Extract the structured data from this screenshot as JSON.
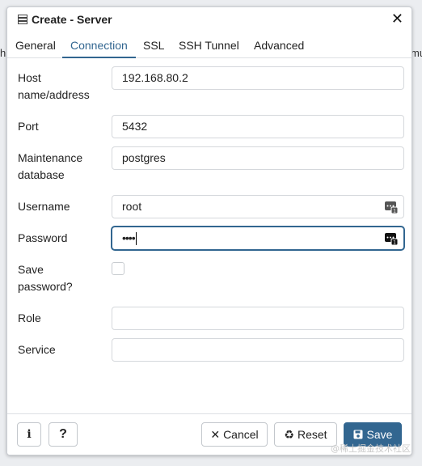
{
  "window": {
    "title": "Create - Server"
  },
  "tabs": [
    {
      "label": "General"
    },
    {
      "label": "Connection"
    },
    {
      "label": "SSL"
    },
    {
      "label": "SSH Tunnel"
    },
    {
      "label": "Advanced"
    }
  ],
  "active_tab": "Connection",
  "fields": {
    "host": {
      "label": "Host name/address",
      "value": "192.168.80.2"
    },
    "port": {
      "label": "Port",
      "value": "5432"
    },
    "maintenance_db": {
      "label": "Maintenance database",
      "value": "postgres"
    },
    "username": {
      "label": "Username",
      "value": "root"
    },
    "password": {
      "label": "Password",
      "value": "••••"
    },
    "save_password": {
      "label": "Save password?",
      "checked": false
    },
    "role": {
      "label": "Role",
      "value": ""
    },
    "service": {
      "label": "Service",
      "value": ""
    }
  },
  "footer": {
    "info_label": "i",
    "help_label": "?",
    "cancel_label": "Cancel",
    "reset_label": "Reset",
    "save_label": "Save"
  },
  "background": {
    "left_edge_text": "h",
    "right_edge_text": "mu"
  },
  "watermark": "@稀土掘金技术社区",
  "colors": {
    "accent": "#326690",
    "border": "#d5d8dc",
    "text": "#222222"
  }
}
